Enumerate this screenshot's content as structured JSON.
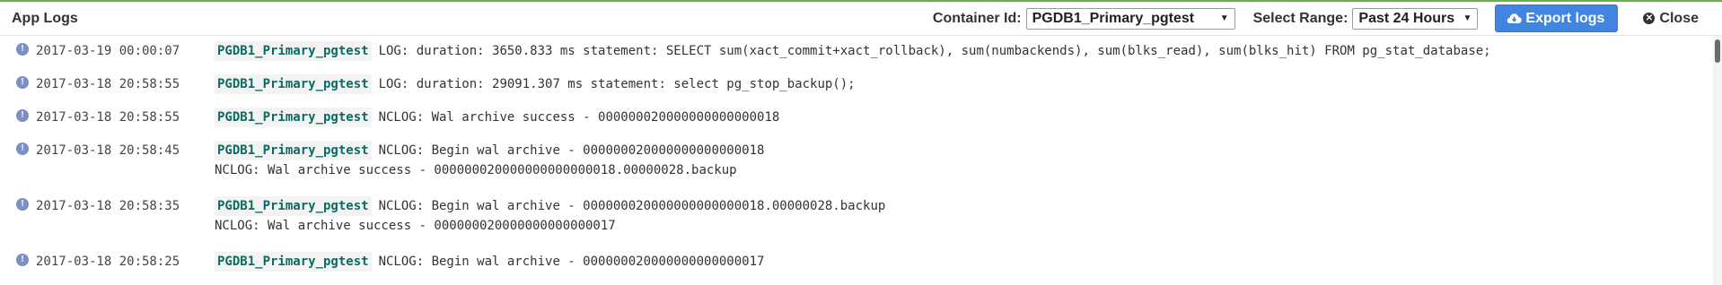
{
  "header": {
    "title": "App Logs",
    "container_label": "Container Id:",
    "container_value": "PGDB1_Primary_pgtest",
    "range_label": "Select Range:",
    "range_value": "Past 24 Hours",
    "export_label": "Export logs",
    "close_label": "Close"
  },
  "logs": [
    {
      "timestamp": "2017-03-19 00:00:07",
      "container": "PGDB1_Primary_pgtest",
      "lines": [
        "LOG: duration: 3650.833 ms statement: SELECT sum(xact_commit+xact_rollback), sum(numbackends), sum(blks_read), sum(blks_hit) FROM pg_stat_database;"
      ]
    },
    {
      "timestamp": "2017-03-18 20:58:55",
      "container": "PGDB1_Primary_pgtest",
      "lines": [
        "LOG: duration: 29091.307 ms statement: select pg_stop_backup();"
      ]
    },
    {
      "timestamp": "2017-03-18 20:58:55",
      "container": "PGDB1_Primary_pgtest",
      "lines": [
        "NCLOG: Wal archive success - 000000020000000000000018"
      ]
    },
    {
      "timestamp": "2017-03-18 20:58:45",
      "container": "PGDB1_Primary_pgtest",
      "lines": [
        "NCLOG: Begin wal archive - 000000020000000000000018",
        "NCLOG: Wal archive success - 000000020000000000000018.00000028.backup"
      ]
    },
    {
      "timestamp": "2017-03-18 20:58:35",
      "container": "PGDB1_Primary_pgtest",
      "lines": [
        "NCLOG: Begin wal archive - 000000020000000000000018.00000028.backup",
        "NCLOG: Wal archive success - 000000020000000000000017"
      ]
    },
    {
      "timestamp": "2017-03-18 20:58:25",
      "container": "PGDB1_Primary_pgtest",
      "lines": [
        "NCLOG: Begin wal archive - 000000020000000000000017"
      ]
    }
  ],
  "colors": {
    "accent_top_border": "#6ab04c",
    "export_button": "#4285e0",
    "container_tag_text": "#0b6b63",
    "info_icon": "#7c8fc4"
  },
  "icons": {
    "log_level": "info-circle-icon",
    "export": "cloud-download-icon",
    "close": "close-circle-icon",
    "dropdown": "caret-down-icon"
  }
}
